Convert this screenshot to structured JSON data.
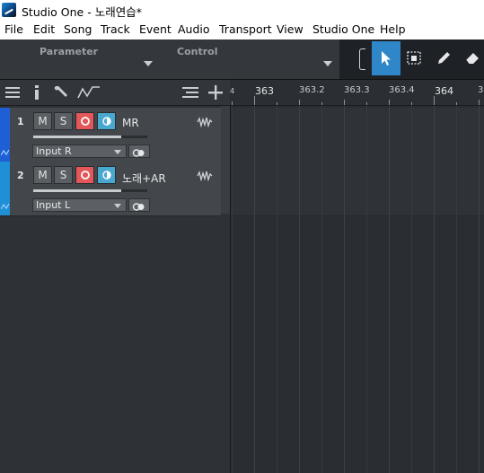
{
  "window": {
    "title": "Studio One - 노래연습*"
  },
  "menu": [
    "File",
    "Edit",
    "Song",
    "Track",
    "Event",
    "Audio",
    "Transport",
    "View",
    "Studio One",
    "Help"
  ],
  "toolbar": {
    "parameter_label": "Parameter",
    "control_label": "Control"
  },
  "ruler": {
    "marks": [
      "363",
      "363.2",
      "363.3",
      "363.4",
      "364",
      "3"
    ],
    "left_marker": "4"
  },
  "tracks": [
    {
      "number": "1",
      "name": "MR",
      "input": "Input R",
      "m": "M",
      "s": "S",
      "color": "#1f5fd6"
    },
    {
      "number": "2",
      "name": "노래+AR",
      "input": "Input L",
      "m": "M",
      "s": "S",
      "color": "#1f8fd6"
    }
  ],
  "colors": {
    "accent": "#2f86c9",
    "record": "#e3565a",
    "monitor": "#47a8d0"
  }
}
